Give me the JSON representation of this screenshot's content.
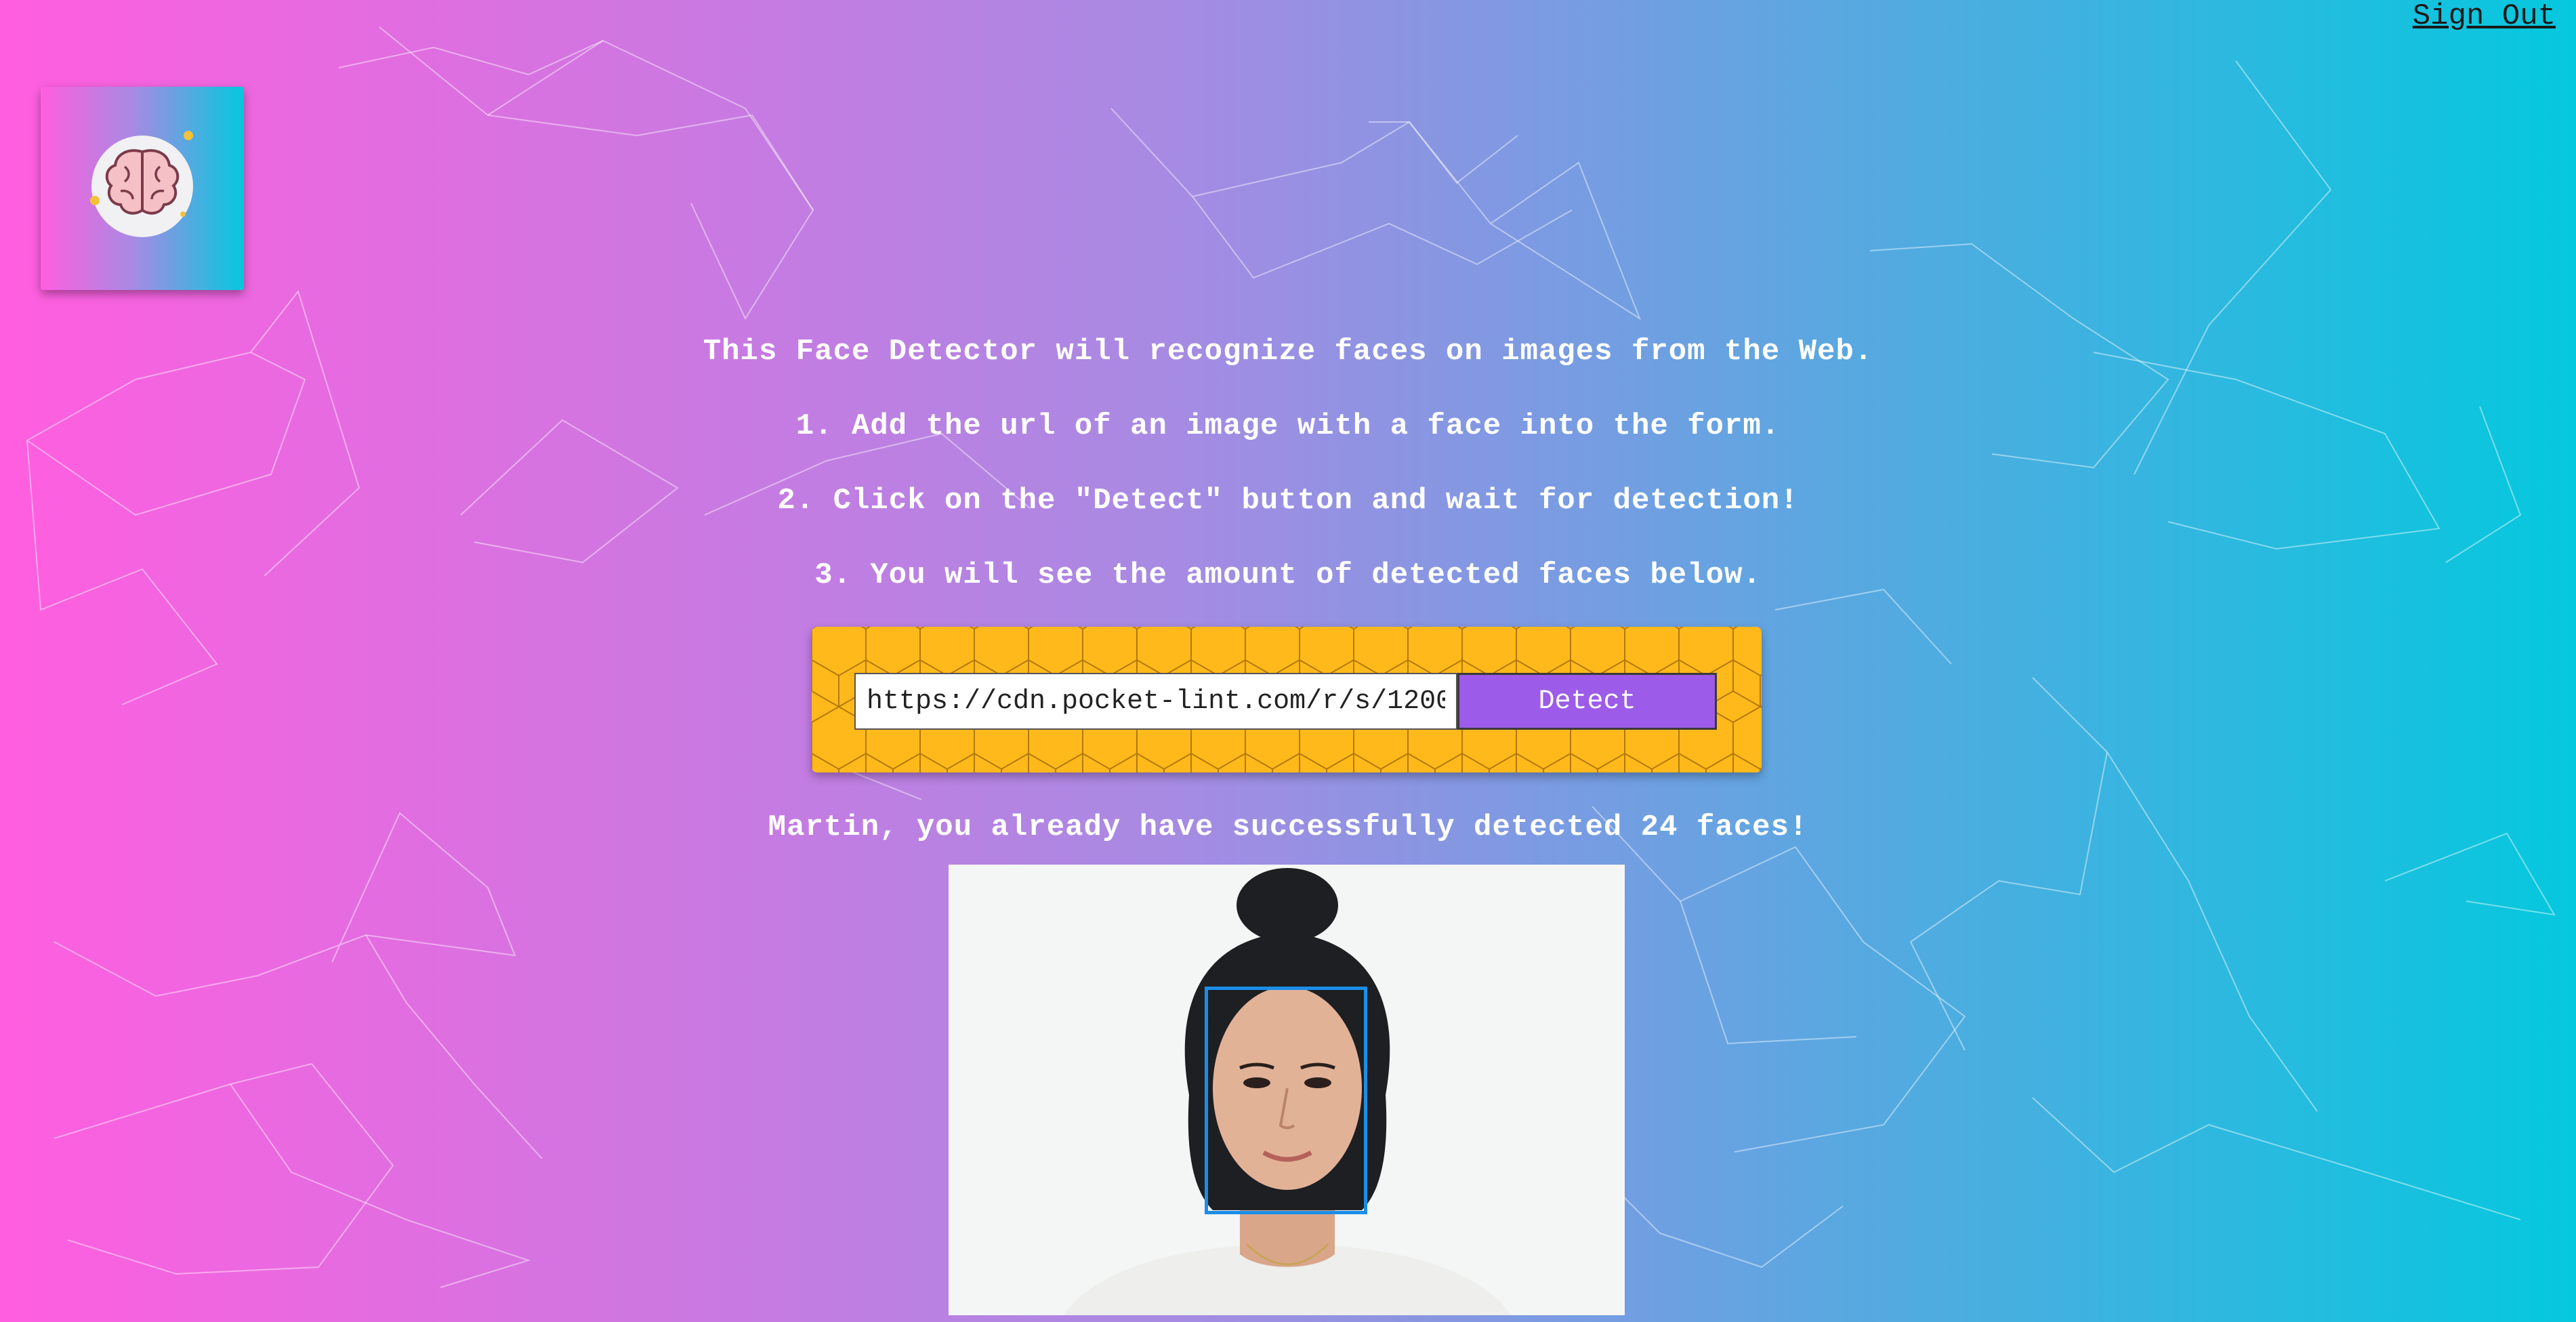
{
  "header": {
    "sign_out_label": "Sign Out"
  },
  "logo": {
    "icon": "brain-icon"
  },
  "instructions": {
    "intro": "This Face Detector will recognize faces on images from the Web.",
    "step1": "1. Add the url of an image with a face into the form.",
    "step2": "2. Click on the \"Detect\" button and wait for detection!",
    "step3": "3. You will see the amount of detected faces below."
  },
  "form": {
    "url_value": "https://cdn.pocket-lint.com/r/s/1200",
    "detect_label": "Detect"
  },
  "result": {
    "message": "Martin, you already have successfully detected 24 faces!"
  },
  "colors": {
    "gradient_start": "#ff5edf",
    "gradient_mid": "#a88ae3",
    "gradient_end": "#04c8de",
    "form_panel": "#ffb91a",
    "detect_button": "#9c5be8",
    "face_box": "#1b8ee8"
  }
}
